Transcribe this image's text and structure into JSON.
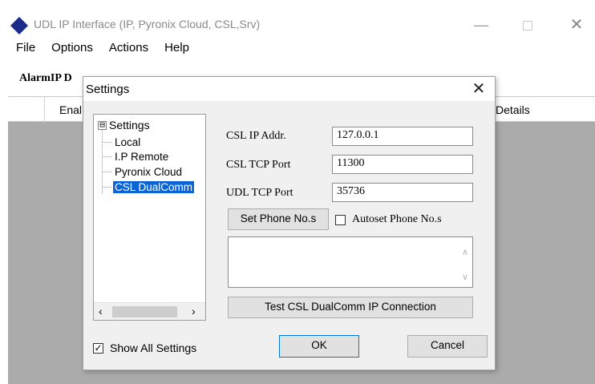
{
  "window": {
    "title": "UDL IP Interface (IP, Pyronix Cloud, CSL,Srv)",
    "menu": [
      "File",
      "Options",
      "Actions",
      "Help"
    ],
    "subheader": "AlarmIP D",
    "grid_columns": [
      "Enal",
      "Details"
    ],
    "icons": {
      "app": "diamond-icon",
      "minimize": "minimize-icon",
      "maximize": "maximize-icon",
      "close": "close-icon"
    },
    "accent_color": "#1a2b8c"
  },
  "dialog": {
    "title": "Settings",
    "tree": {
      "root": "Settings",
      "expander": "⊟",
      "children": [
        "Local",
        "I.P Remote",
        "Pyronix Cloud",
        "CSL DualComm"
      ],
      "selected": "CSL DualComm",
      "selection_color": "#0a64d6"
    },
    "fields": [
      {
        "label": "CSL IP Addr.",
        "value": "127.0.0.1"
      },
      {
        "label": "CSL TCP Port",
        "value": "11300"
      },
      {
        "label": "UDL TCP Port",
        "value": "35736"
      }
    ],
    "set_phone_button": "Set Phone No.s",
    "autoset_label": "Autoset Phone No.s",
    "autoset_checked": false,
    "test_button": "Test CSL DualComm IP Connection",
    "show_all_label": "Show All Settings",
    "show_all_checked": true,
    "ok_button": "OK",
    "cancel_button": "Cancel"
  }
}
